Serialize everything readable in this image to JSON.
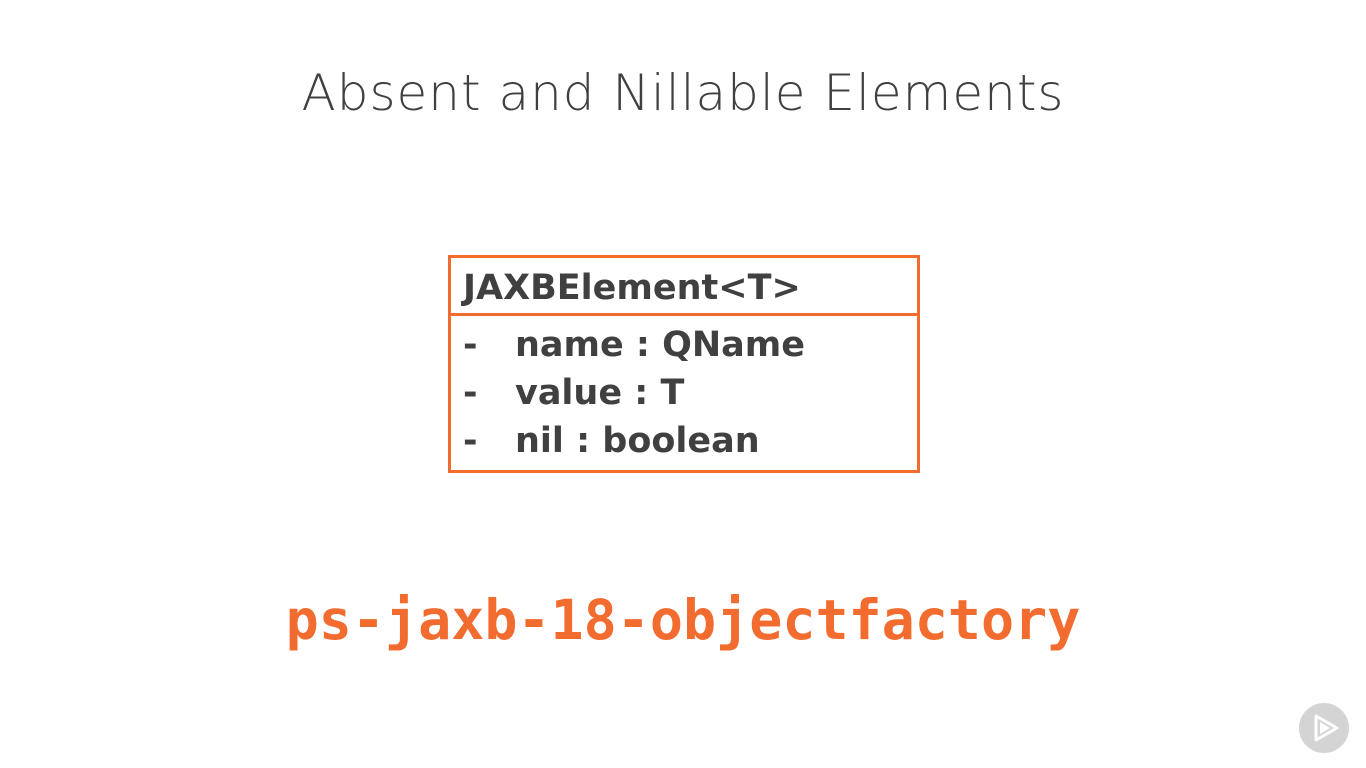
{
  "slide": {
    "title": "Absent and Nillable Elements"
  },
  "uml_class": {
    "name": "JAXBElement<T>",
    "attributes": [
      {
        "visibility": "-",
        "text": "name : QName"
      },
      {
        "visibility": "-",
        "text": "value : T"
      },
      {
        "visibility": "-",
        "text": "nil : boolean"
      }
    ]
  },
  "repo_label": "ps-jaxb-18-objectfactory",
  "logo": {
    "icon": "play-icon"
  },
  "colors": {
    "accent": "#f26b2f",
    "text": "#404040",
    "background": "#ffffff",
    "badge": "#d4d4d4"
  }
}
